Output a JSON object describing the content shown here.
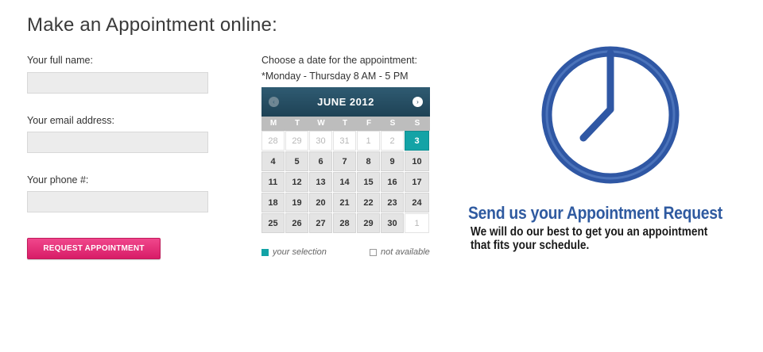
{
  "page": {
    "title": "Make an Appointment online:"
  },
  "form": {
    "name_label": "Your full name:",
    "name_value": "",
    "email_label": "Your email address:",
    "email_value": "",
    "phone_label": "Your phone #:",
    "phone_value": "",
    "submit_label": "REQUEST APPOINTMENT"
  },
  "calendar": {
    "prompt": "Choose a date for the appointment:",
    "hours": "*Monday - Thursday 8 AM - 5 PM",
    "month_label": "JUNE 2012",
    "prev_icon": "‹",
    "next_icon": "›",
    "weekdays": [
      "M",
      "T",
      "W",
      "T",
      "F",
      "S",
      "S"
    ],
    "days": [
      {
        "label": "28",
        "state": "outside"
      },
      {
        "label": "29",
        "state": "outside"
      },
      {
        "label": "30",
        "state": "outside"
      },
      {
        "label": "31",
        "state": "outside"
      },
      {
        "label": "1",
        "state": "outside"
      },
      {
        "label": "2",
        "state": "outside"
      },
      {
        "label": "3",
        "state": "selected"
      },
      {
        "label": "4",
        "state": "available"
      },
      {
        "label": "5",
        "state": "available"
      },
      {
        "label": "6",
        "state": "available"
      },
      {
        "label": "7",
        "state": "available"
      },
      {
        "label": "8",
        "state": "available"
      },
      {
        "label": "9",
        "state": "available"
      },
      {
        "label": "10",
        "state": "available"
      },
      {
        "label": "11",
        "state": "available"
      },
      {
        "label": "12",
        "state": "available"
      },
      {
        "label": "13",
        "state": "available"
      },
      {
        "label": "14",
        "state": "available"
      },
      {
        "label": "15",
        "state": "available"
      },
      {
        "label": "16",
        "state": "available"
      },
      {
        "label": "17",
        "state": "available"
      },
      {
        "label": "18",
        "state": "available"
      },
      {
        "label": "19",
        "state": "available"
      },
      {
        "label": "20",
        "state": "available"
      },
      {
        "label": "21",
        "state": "available"
      },
      {
        "label": "22",
        "state": "available"
      },
      {
        "label": "23",
        "state": "available"
      },
      {
        "label": "24",
        "state": "available"
      },
      {
        "label": "25",
        "state": "available"
      },
      {
        "label": "26",
        "state": "available"
      },
      {
        "label": "27",
        "state": "available"
      },
      {
        "label": "28",
        "state": "available"
      },
      {
        "label": "29",
        "state": "available"
      },
      {
        "label": "30",
        "state": "available"
      },
      {
        "label": "1",
        "state": "outside"
      }
    ],
    "legend_selection": "your selection",
    "legend_unavailable": "not available"
  },
  "promo": {
    "icon": "clock-icon",
    "title": "Send us your Appointment Request",
    "text": "We will do our best to get you an appointment that fits your schedule."
  },
  "colors": {
    "title_blue": "#2f5aa0",
    "calendar_header": "#2f5b72",
    "selection_teal": "#13a3a6",
    "button_pink": "#e0286f",
    "clock_blue": "#2f57a4"
  }
}
